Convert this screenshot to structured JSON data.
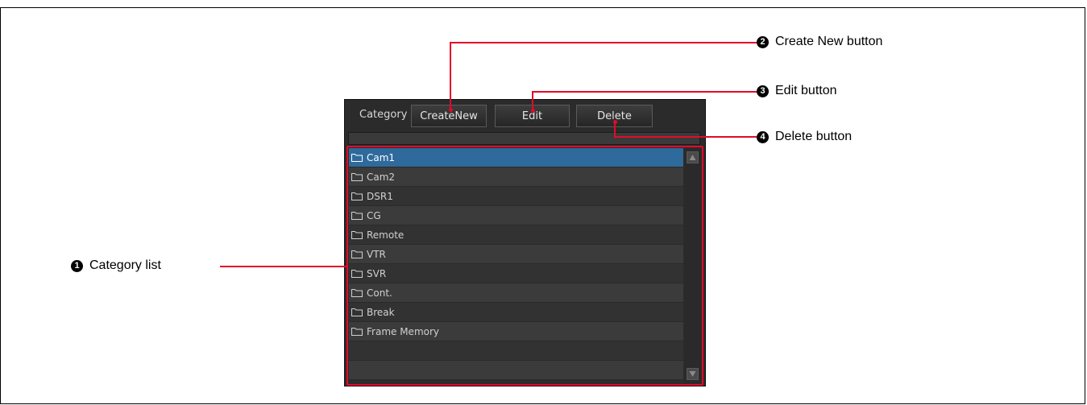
{
  "toolbar": {
    "category_label": "Category",
    "create_new_label": "CreateNew",
    "edit_label": "Edit",
    "delete_label": "Delete"
  },
  "categories": [
    {
      "label": "Cam1",
      "selected": true
    },
    {
      "label": "Cam2"
    },
    {
      "label": "DSR1"
    },
    {
      "label": "CG"
    },
    {
      "label": "Remote"
    },
    {
      "label": "VTR"
    },
    {
      "label": "SVR"
    },
    {
      "label": "Cont."
    },
    {
      "label": "Break"
    },
    {
      "label": "Frame Memory"
    }
  ],
  "callouts": {
    "c1": {
      "num": "1",
      "label": "Category list"
    },
    "c2": {
      "num": "2",
      "label": "Create New button"
    },
    "c3": {
      "num": "3",
      "label": "Edit button"
    },
    "c4": {
      "num": "4",
      "label": "Delete button"
    }
  },
  "colors": {
    "callout_red": "#e20a2a",
    "selected_row": "#2f6a9c",
    "panel_bg": "#2b2b2b"
  }
}
